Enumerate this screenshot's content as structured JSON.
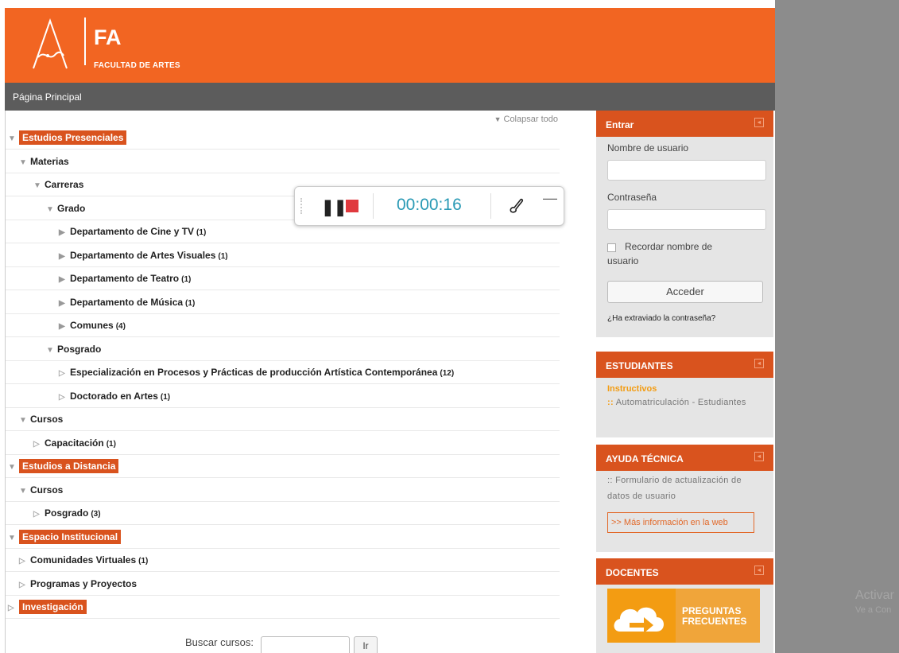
{
  "header": {
    "logo_initials": "FA",
    "logo_subtitle": "FACULTAD DE ARTES"
  },
  "navbar": {
    "home_label": "Página Principal"
  },
  "course_tree": {
    "collapse_all_label": "Colapsar todo",
    "rows": [
      {
        "label": "Estudios Presenciales",
        "count": "",
        "level": 0,
        "state": "expanded",
        "highlight": true
      },
      {
        "label": "Materias",
        "count": "",
        "level": 1,
        "state": "expanded",
        "highlight": false
      },
      {
        "label": "Carreras",
        "count": "",
        "level": 2,
        "state": "expanded",
        "highlight": false
      },
      {
        "label": "Grado",
        "count": "",
        "level": 3,
        "state": "expanded",
        "highlight": false
      },
      {
        "label": "Departamento de Cine y TV",
        "count": "(1)",
        "level": 4,
        "state": "collapsed",
        "highlight": false
      },
      {
        "label": "Departamento de Artes Visuales",
        "count": "(1)",
        "level": 4,
        "state": "collapsed",
        "highlight": false
      },
      {
        "label": "Departamento de Teatro",
        "count": "(1)",
        "level": 4,
        "state": "collapsed",
        "highlight": false
      },
      {
        "label": "Departamento de Música",
        "count": "(1)",
        "level": 4,
        "state": "collapsed",
        "highlight": false
      },
      {
        "label": "Comunes",
        "count": "(4)",
        "level": 4,
        "state": "collapsed",
        "highlight": false
      },
      {
        "label": "Posgrado",
        "count": "",
        "level": 3,
        "state": "expanded",
        "highlight": false
      },
      {
        "label": "Especialización en Procesos y Prácticas de producción Artística Contemporánea",
        "count": "(12)",
        "level": 4,
        "state": "empty",
        "highlight": false
      },
      {
        "label": "Doctorado en Artes",
        "count": "(1)",
        "level": 4,
        "state": "empty",
        "highlight": false
      },
      {
        "label": "Cursos",
        "count": "",
        "level": 1,
        "state": "expanded",
        "highlight": false
      },
      {
        "label": "Capacitación",
        "count": "(1)",
        "level": 2,
        "state": "empty",
        "highlight": false
      },
      {
        "label": "Estudios a Distancia",
        "count": "",
        "level": 0,
        "state": "expanded",
        "highlight": true
      },
      {
        "label": "Cursos",
        "count": "",
        "level": 1,
        "state": "expanded",
        "highlight": false
      },
      {
        "label": "Posgrado",
        "count": "(3)",
        "level": 2,
        "state": "empty",
        "highlight": false
      },
      {
        "label": "Espacio Institucional",
        "count": "",
        "level": 0,
        "state": "expanded",
        "highlight": true
      },
      {
        "label": "Comunidades Virtuales",
        "count": "(1)",
        "level": 1,
        "state": "empty",
        "highlight": false
      },
      {
        "label": "Programas y Proyectos",
        "count": "",
        "level": 1,
        "state": "empty",
        "highlight": false
      },
      {
        "label": "Investigación",
        "count": "",
        "level": 0,
        "state": "empty",
        "highlight": true
      }
    ]
  },
  "recorder": {
    "time": "00:00:16"
  },
  "search": {
    "label": "Buscar cursos:",
    "button": "Ir",
    "value": ""
  },
  "login": {
    "title": "Entrar",
    "username_label": "Nombre de usuario",
    "password_label": "Contraseña",
    "remember_line1": "Recordar nombre de",
    "remember_line2": "usuario",
    "submit": "Acceder",
    "forgot": "¿Ha extraviado la contraseña?"
  },
  "students": {
    "title": "ESTUDIANTES",
    "subtitle": "Instructivos",
    "link_prefix": "::",
    "link": "Automatriculación - Estudiantes"
  },
  "tech_help": {
    "title": "AYUDA TÉCNICA",
    "link_line1": ":: Formulario de actualización de",
    "link_line2": "datos de usuario",
    "more_info": ">> Más información en la web"
  },
  "teachers": {
    "title": "DOCENTES",
    "faq_line1": "PREGUNTAS",
    "faq_line2": "FRECUENTES"
  },
  "os_overlay": {
    "line1": "Activar",
    "line2": "Ve a Con"
  },
  "colors": {
    "brand_orange": "#f26522",
    "block_header": "#d9531e",
    "nav_gray": "#5c5c5c",
    "timer_blue": "#2a9ab5",
    "stop_red": "#e0393e"
  }
}
